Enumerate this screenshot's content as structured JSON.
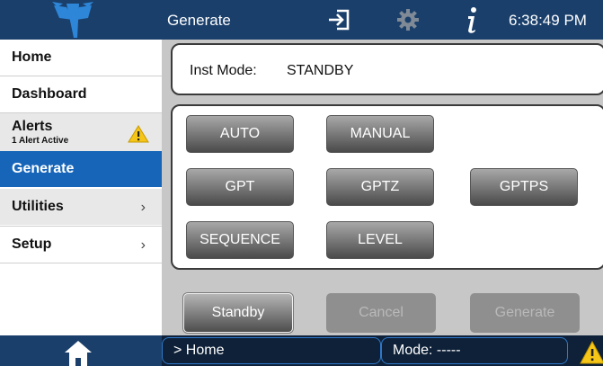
{
  "header": {
    "screen_title": "Generate",
    "clock": "6:38:49 PM",
    "icons": {
      "logo": "teledyne-logo-icon",
      "login": "login-icon",
      "settings": "gear-icon",
      "info": "info-icon"
    }
  },
  "sidebar": {
    "items": [
      {
        "label": "Home"
      },
      {
        "label": "Dashboard"
      },
      {
        "label": "Alerts",
        "sub": "1 Alert Active",
        "icon": "warning-icon"
      },
      {
        "label": "Generate",
        "selected": true
      },
      {
        "label": "Utilities",
        "chevron": "›"
      },
      {
        "label": "Setup",
        "chevron": "›"
      }
    ]
  },
  "main": {
    "mode_label": "Inst Mode:",
    "mode_value": "STANDBY",
    "mode_buttons": [
      "AUTO",
      "MANUAL",
      "GPT",
      "GPTZ",
      "GPTPS",
      "SEQUENCE",
      "LEVEL"
    ],
    "actions": {
      "standby": "Standby",
      "cancel": "Cancel",
      "generate": "Generate"
    }
  },
  "footer": {
    "breadcrumb": "> Home",
    "mode_status": "Mode: -----",
    "home_icon": "home-icon",
    "warning_icon": "warning-icon"
  },
  "colors": {
    "header_bg": "#1a3f6b",
    "selected_nav": "#1665b8",
    "warning": "#f5c518",
    "footer_bg": "#0e2138"
  }
}
